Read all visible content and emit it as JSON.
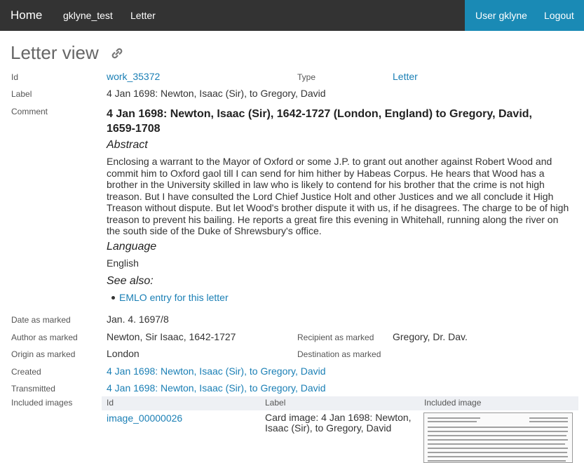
{
  "nav": {
    "home": "Home",
    "dataset": "gklyne_test",
    "letter": "Letter",
    "user": "User gklyne",
    "logout": "Logout"
  },
  "page_title": "Letter view",
  "fields": {
    "id_label": "Id",
    "id_value": "work_35372",
    "type_label": "Type",
    "type_value": "Letter",
    "label_label": "Label",
    "label_value": "4 Jan 1698: Newton, Isaac (Sir), to Gregory, David",
    "comment_label": "Comment",
    "date_label": "Date as marked",
    "date_value": "Jan. 4. 1697/8",
    "author_label": "Author as marked",
    "author_value": "Newton, Sir Isaac, 1642-1727",
    "recipient_label": "Recipient as marked",
    "recipient_value": "Gregory, Dr. Dav.",
    "origin_label": "Origin as marked",
    "origin_value": "London",
    "destination_label": "Destination as marked",
    "created_label": "Created",
    "created_value": "4 Jan 1698: Newton, Isaac (Sir), to Gregory, David",
    "transmitted_label": "Transmitted",
    "transmitted_value": "4 Jan 1698: Newton, Isaac (Sir), to Gregory, David",
    "images_label": "Included images"
  },
  "comment": {
    "title": "4 Jan 1698: Newton, Isaac (Sir), 1642-1727 (London, England) to Gregory, David, 1659-1708",
    "abstract_heading": "Abstract",
    "abstract_text": "Enclosing a warrant to the Mayor of Oxford or some J.P. to grant out another against Robert Wood and commit him to Oxford gaol till I can send for him hither by Habeas Corpus. He hears that Wood has a brother in the University skilled in law who is likely to contend for his brother that the crime is not high treason. But I have consulted the Lord Chief Justice Holt and other Justices and we all conclude it High Treason without dispute. But let Wood's brother dispute it with us, if he disagrees. The charge to be of high treason to prevent his bailing. He reports a great fire this evening in Whitehall, running along the river on the south side of the Duke of Shrewsbury's office.",
    "language_heading": "Language",
    "language_value": "English",
    "see_also_heading": "See also:",
    "see_also_link": "EMLO entry for this letter"
  },
  "images_table": {
    "headers": [
      "Id",
      "Label",
      "Included image"
    ],
    "rows": [
      {
        "id": "image_00000026",
        "label": "Card image: 4 Jan 1698: Newton, Isaac (Sir), to Gregory, David"
      }
    ]
  }
}
